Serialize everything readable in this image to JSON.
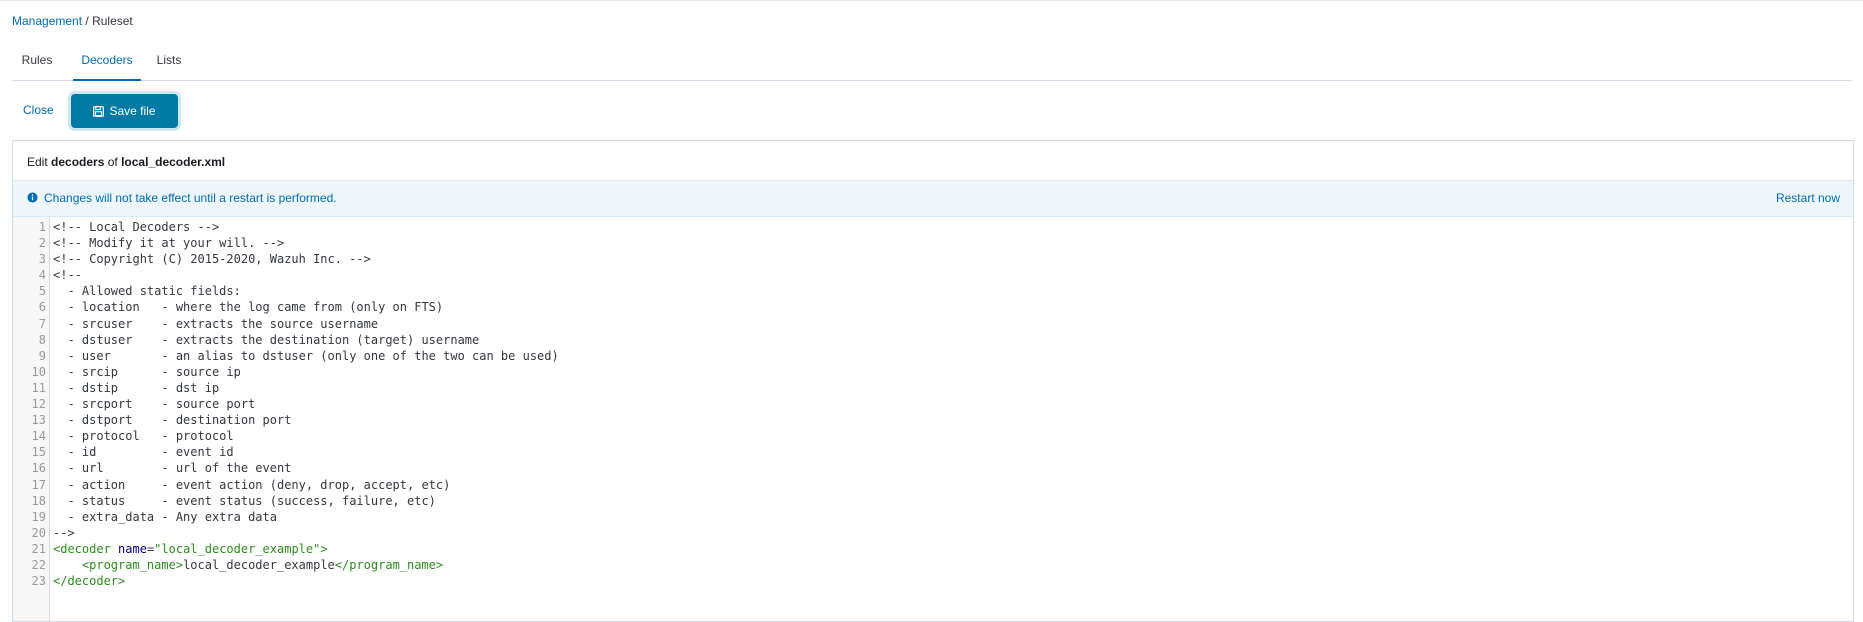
{
  "breadcrumb": {
    "parent": "Management",
    "separator": " / ",
    "current": "Ruleset"
  },
  "tabs": [
    {
      "label": "Rules",
      "active": false
    },
    {
      "label": "Decoders",
      "active": true
    },
    {
      "label": "Lists",
      "active": false
    }
  ],
  "actions": {
    "close_label": "Close",
    "save_label": "Save file",
    "save_icon": "save-icon"
  },
  "panel": {
    "prefix": "Edit",
    "type": "decoders",
    "of": "of",
    "filename": "local_decoder.xml"
  },
  "callout": {
    "icon": "info-icon",
    "message": "Changes will not take effect until a restart is performed.",
    "restart_label": "Restart now"
  },
  "colors": {
    "accent": "#006bb4",
    "button": "#0079a5",
    "callout_bg": "#eef6fb",
    "xml_tag": "#2e8b1e",
    "xml_attr": "#00007f"
  },
  "editor": {
    "lines": [
      [
        {
          "t": "comment",
          "v": "<!-- Local Decoders -->"
        }
      ],
      [
        {
          "t": "comment",
          "v": "<!-- Modify it at your will. -->"
        }
      ],
      [
        {
          "t": "comment",
          "v": "<!-- Copyright (C) 2015-2020, Wazuh Inc. -->"
        }
      ],
      [
        {
          "t": "comment",
          "v": "<!--"
        }
      ],
      [
        {
          "t": "comment",
          "v": "  - Allowed static fields:"
        }
      ],
      [
        {
          "t": "comment",
          "v": "  - location   - where the log came from (only on FTS)"
        }
      ],
      [
        {
          "t": "comment",
          "v": "  - srcuser    - extracts the source username"
        }
      ],
      [
        {
          "t": "comment",
          "v": "  - dstuser    - extracts the destination (target) username"
        }
      ],
      [
        {
          "t": "comment",
          "v": "  - user       - an alias to dstuser (only one of the two can be used)"
        }
      ],
      [
        {
          "t": "comment",
          "v": "  - srcip      - source ip"
        }
      ],
      [
        {
          "t": "comment",
          "v": "  - dstip      - dst ip"
        }
      ],
      [
        {
          "t": "comment",
          "v": "  - srcport    - source port"
        }
      ],
      [
        {
          "t": "comment",
          "v": "  - dstport    - destination port"
        }
      ],
      [
        {
          "t": "comment",
          "v": "  - protocol   - protocol"
        }
      ],
      [
        {
          "t": "comment",
          "v": "  - id         - event id"
        }
      ],
      [
        {
          "t": "comment",
          "v": "  - url        - url of the event"
        }
      ],
      [
        {
          "t": "comment",
          "v": "  - action     - event action (deny, drop, accept, etc)"
        }
      ],
      [
        {
          "t": "comment",
          "v": "  - status     - event status (success, failure, etc)"
        }
      ],
      [
        {
          "t": "comment",
          "v": "  - extra_data - Any extra data"
        }
      ],
      [
        {
          "t": "comment",
          "v": "-->"
        }
      ],
      [
        {
          "t": "tag",
          "v": "<decoder "
        },
        {
          "t": "attr",
          "v": "name"
        },
        {
          "t": "text",
          "v": "="
        },
        {
          "t": "str",
          "v": "\"local_decoder_example\""
        },
        {
          "t": "tag",
          "v": ">"
        }
      ],
      [
        {
          "t": "text",
          "v": "    "
        },
        {
          "t": "tag",
          "v": "<program_name>"
        },
        {
          "t": "text",
          "v": "local_decoder_example"
        },
        {
          "t": "tag",
          "v": "</program_name>"
        }
      ],
      [
        {
          "t": "tag",
          "v": "</decoder>"
        }
      ]
    ]
  }
}
